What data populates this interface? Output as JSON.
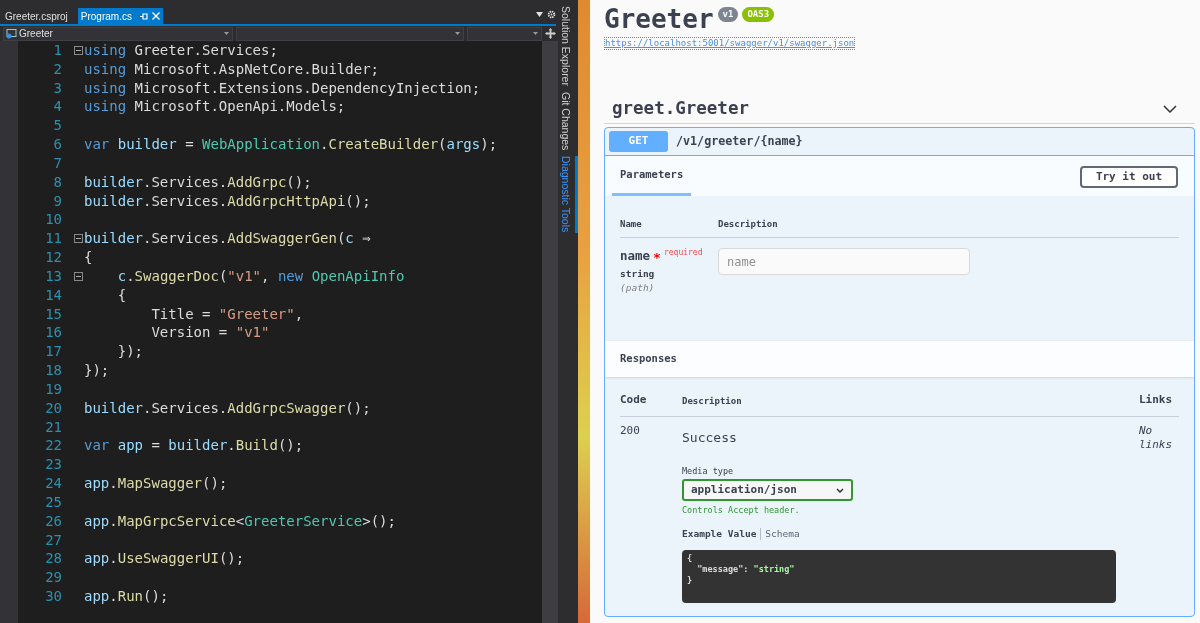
{
  "editor": {
    "tabs": [
      {
        "label": "Greeter.csproj",
        "selected": false
      },
      {
        "label": "Program.cs",
        "selected": true
      }
    ],
    "nav": {
      "project": "Greeter"
    },
    "lines": [
      {
        "number": "1",
        "fold": true,
        "tokens": [
          {
            "kind": "kw",
            "text": "using"
          },
          {
            "kind": "plain",
            "text": " Greeter.Services;"
          }
        ]
      },
      {
        "number": "2",
        "fold": false,
        "tokens": [
          {
            "kind": "kw",
            "text": "using"
          },
          {
            "kind": "plain",
            "text": " Microsoft.AspNetCore.Builder;"
          }
        ]
      },
      {
        "number": "3",
        "fold": false,
        "tokens": [
          {
            "kind": "kw",
            "text": "using"
          },
          {
            "kind": "plain",
            "text": " Microsoft.Extensions.DependencyInjection;"
          }
        ]
      },
      {
        "number": "4",
        "fold": false,
        "tokens": [
          {
            "kind": "kw",
            "text": "using"
          },
          {
            "kind": "plain",
            "text": " Microsoft.OpenApi.Models;"
          }
        ]
      },
      {
        "number": "5",
        "fold": false
      },
      {
        "number": "6",
        "fold": false,
        "tokens": [
          {
            "kind": "kw",
            "text": "var "
          },
          {
            "kind": "ident",
            "text": "builder"
          },
          {
            "kind": "plain",
            "text": " = "
          },
          {
            "kind": "type",
            "text": "WebApplication"
          },
          {
            "kind": "plain",
            "text": "."
          },
          {
            "kind": "method",
            "text": "CreateBuilder"
          },
          {
            "kind": "plain",
            "text": "("
          },
          {
            "kind": "ident",
            "text": "args"
          },
          {
            "kind": "plain",
            "text": ");"
          }
        ]
      },
      {
        "number": "7",
        "fold": false
      },
      {
        "number": "8",
        "fold": false,
        "tokens": [
          {
            "kind": "ident",
            "text": "builder"
          },
          {
            "kind": "plain",
            "text": ".Services."
          },
          {
            "kind": "method",
            "text": "AddGrpc"
          },
          {
            "kind": "plain",
            "text": "();"
          }
        ]
      },
      {
        "number": "9",
        "fold": false,
        "tokens": [
          {
            "kind": "ident",
            "text": "builder"
          },
          {
            "kind": "plain",
            "text": ".Services."
          },
          {
            "kind": "method",
            "text": "AddGrpcHttpApi"
          },
          {
            "kind": "plain",
            "text": "();"
          }
        ]
      },
      {
        "number": "10",
        "fold": false
      },
      {
        "number": "11",
        "fold": true,
        "tokens": [
          {
            "kind": "ident",
            "text": "builder"
          },
          {
            "kind": "plain",
            "text": ".Services."
          },
          {
            "kind": "method",
            "text": "AddSwaggerGen"
          },
          {
            "kind": "plain",
            "text": "("
          },
          {
            "kind": "ident",
            "text": "c"
          },
          {
            "kind": "plain",
            "text": " ⇒"
          }
        ]
      },
      {
        "number": "12",
        "fold": false,
        "tokens": [
          {
            "kind": "plain",
            "text": "{"
          }
        ]
      },
      {
        "number": "13",
        "fold": true,
        "tokens": [
          {
            "kind": "ident",
            "text": "    c"
          },
          {
            "kind": "plain",
            "text": "."
          },
          {
            "kind": "method",
            "text": "SwaggerDoc"
          },
          {
            "kind": "plain",
            "text": "("
          },
          {
            "kind": "string",
            "text": "\"v1\""
          },
          {
            "kind": "plain",
            "text": ", "
          },
          {
            "kind": "kw",
            "text": "new "
          },
          {
            "kind": "type",
            "text": "OpenApiInfo"
          }
        ]
      },
      {
        "number": "14",
        "fold": false,
        "tokens": [
          {
            "kind": "plain",
            "text": "    {"
          }
        ]
      },
      {
        "number": "15",
        "fold": false,
        "tokens": [
          {
            "kind": "plain",
            "text": "        Title = "
          },
          {
            "kind": "string",
            "text": "\"Greeter\""
          },
          {
            "kind": "plain",
            "text": ","
          }
        ]
      },
      {
        "number": "16",
        "fold": false,
        "tokens": [
          {
            "kind": "plain",
            "text": "        Version = "
          },
          {
            "kind": "string",
            "text": "\"v1\""
          }
        ]
      },
      {
        "number": "17",
        "fold": false,
        "tokens": [
          {
            "kind": "plain",
            "text": "    });"
          }
        ]
      },
      {
        "number": "18",
        "fold": false,
        "tokens": [
          {
            "kind": "plain",
            "text": "});"
          }
        ]
      },
      {
        "number": "19",
        "fold": false
      },
      {
        "number": "20",
        "fold": false,
        "tokens": [
          {
            "kind": "ident",
            "text": "builder"
          },
          {
            "kind": "plain",
            "text": ".Services."
          },
          {
            "kind": "method",
            "text": "AddGrpcSwagger"
          },
          {
            "kind": "plain",
            "text": "();"
          }
        ]
      },
      {
        "number": "21",
        "fold": false
      },
      {
        "number": "22",
        "fold": false,
        "tokens": [
          {
            "kind": "kw",
            "text": "var "
          },
          {
            "kind": "ident",
            "text": "app"
          },
          {
            "kind": "plain",
            "text": " = "
          },
          {
            "kind": "ident",
            "text": "builder"
          },
          {
            "kind": "plain",
            "text": "."
          },
          {
            "kind": "method",
            "text": "Build"
          },
          {
            "kind": "plain",
            "text": "();"
          }
        ]
      },
      {
        "number": "23",
        "fold": false
      },
      {
        "number": "24",
        "fold": false,
        "tokens": [
          {
            "kind": "ident",
            "text": "app"
          },
          {
            "kind": "plain",
            "text": "."
          },
          {
            "kind": "method",
            "text": "MapSwagger"
          },
          {
            "kind": "plain",
            "text": "();"
          }
        ]
      },
      {
        "number": "25",
        "fold": false
      },
      {
        "number": "26",
        "fold": false,
        "tokens": [
          {
            "kind": "ident",
            "text": "app"
          },
          {
            "kind": "plain",
            "text": "."
          },
          {
            "kind": "method",
            "text": "MapGrpcService"
          },
          {
            "kind": "plain",
            "text": "<"
          },
          {
            "kind": "type",
            "text": "GreeterService"
          },
          {
            "kind": "plain",
            "text": ">();"
          }
        ]
      },
      {
        "number": "27",
        "fold": false
      },
      {
        "number": "28",
        "fold": false,
        "tokens": [
          {
            "kind": "ident",
            "text": "app"
          },
          {
            "kind": "plain",
            "text": "."
          },
          {
            "kind": "method",
            "text": "UseSwaggerUI"
          },
          {
            "kind": "plain",
            "text": "();"
          }
        ]
      },
      {
        "number": "29",
        "fold": false
      },
      {
        "number": "30",
        "fold": false,
        "tokens": [
          {
            "kind": "ident",
            "text": "app"
          },
          {
            "kind": "plain",
            "text": "."
          },
          {
            "kind": "method",
            "text": "Run"
          },
          {
            "kind": "plain",
            "text": "();"
          }
        ]
      }
    ]
  },
  "side_tabs": [
    {
      "label": "Solution Explorer",
      "selected": false
    },
    {
      "label": "Git Changes",
      "selected": false
    },
    {
      "label": "Diagnostic Tools",
      "selected": true
    }
  ],
  "swagger": {
    "title": "Greeter",
    "badges": [
      {
        "text": "v1",
        "color": "#7d8492"
      },
      {
        "text": "OAS3",
        "color": "#89bf04"
      }
    ],
    "url": "https://localhost:5001/swagger/v1/swagger.json",
    "tag": {
      "name": "greet.Greeter",
      "expanded": true
    },
    "operation": {
      "method": "GET",
      "path": "/v1/greeter/{name}",
      "tabs": [
        {
          "label": "Parameters",
          "selected": true
        }
      ],
      "try_button": "Try it out",
      "param_columns": [
        "Name",
        "Description"
      ],
      "parameter": {
        "name": "name",
        "required_mark": "*",
        "required": "required",
        "type": "string",
        "location": "(path)",
        "placeholder": "name"
      },
      "responses_title": "Responses",
      "response_columns": [
        "Code",
        "Description",
        "Links"
      ],
      "response": {
        "code": "200",
        "description": "Success",
        "media_label": "Media type",
        "media_type": "application/json",
        "media_hint": "Controls Accept header.",
        "example_tabs": [
          {
            "label": "Example Value",
            "selected": true
          },
          {
            "label": "Schema",
            "selected": false
          }
        ],
        "example": [
          [
            {
              "kind": "plain",
              "text": "{"
            }
          ],
          [
            {
              "kind": "plain",
              "text": "  \"message\": "
            },
            {
              "kind": "jstring",
              "text": "\"string\""
            }
          ],
          [
            {
              "kind": "plain",
              "text": "}"
            }
          ]
        ],
        "links": "No links"
      }
    }
  }
}
